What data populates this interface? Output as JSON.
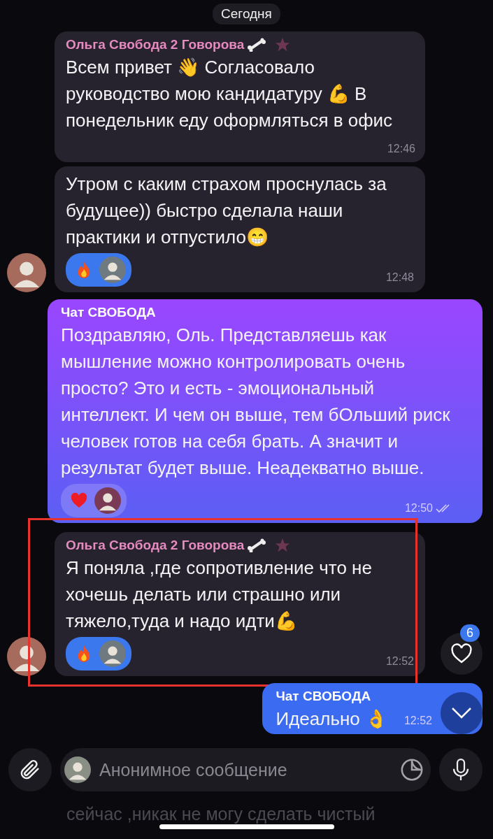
{
  "date_chip": "Сегодня",
  "messages": [
    {
      "kind": "incoming",
      "sender": "Ольга Свобода 2 Говорова",
      "text": "Всем привет 👋 Согласовало руководство мою кандидатуру 💪 В понедельник еду оформляться в офис",
      "time": "12:46",
      "avatar": false,
      "highlighted": false
    },
    {
      "kind": "incoming",
      "text": "Утром с каким страхом проснулась за будущее)) быстро сделала наши практики и отпустило😁",
      "time": "12:48",
      "reaction": {
        "kind": "fire"
      },
      "avatar": true,
      "highlighted": false
    },
    {
      "kind": "outgoing",
      "sender": "Чат СВОБОДА",
      "text": "Поздравляю, Оль. Представляешь как мышление можно контролировать очень просто? Это и есть - эмоциональный интеллект. И чем он выше, тем бОльший риск человек готов на себя брать. А значит и результат будет выше. Неадекватно выше.",
      "time": "12:50",
      "read": true,
      "reaction": {
        "kind": "heart"
      },
      "highlighted": false
    },
    {
      "kind": "incoming",
      "sender": "Ольга Свобода 2 Говорова",
      "text": "Я поняла ,где сопротивление что не хочешь делать или страшно или тяжело,туда и надо идти💪",
      "time": "12:52",
      "reaction": {
        "kind": "fire"
      },
      "avatar": true,
      "highlighted": true
    },
    {
      "kind": "outgoing_short",
      "sender": "Чат СВОБОДА",
      "text": "Идеально 👌",
      "time": "12:52",
      "read": false,
      "highlighted": false
    }
  ],
  "reactions_button": {
    "count": "6"
  },
  "composer": {
    "placeholder": "Анонимное сообщение"
  },
  "text_behind_composer": "сейчас ,никак не могу сделать чистый"
}
